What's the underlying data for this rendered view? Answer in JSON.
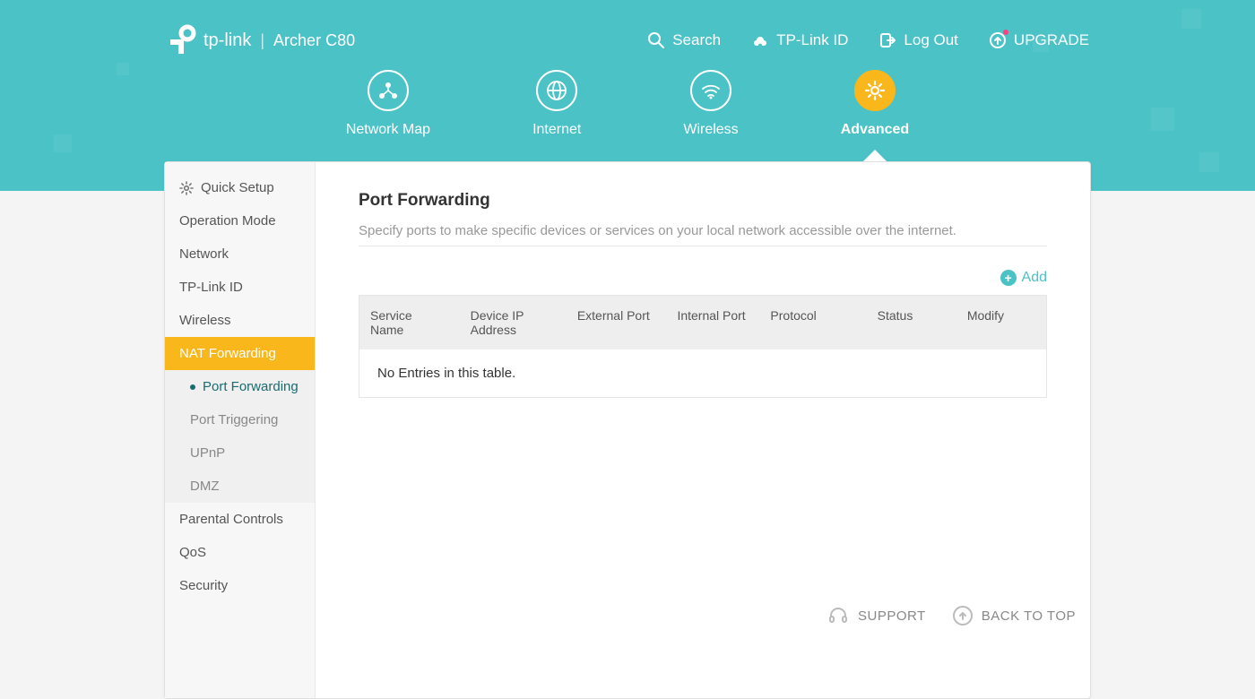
{
  "brand": "tp-link",
  "model": "Archer C80",
  "top_links": {
    "search": "Search",
    "tplink_id": "TP-Link ID",
    "logout": "Log Out",
    "upgrade": "UPGRADE"
  },
  "tabs": {
    "network_map": "Network Map",
    "internet": "Internet",
    "wireless": "Wireless",
    "advanced": "Advanced"
  },
  "sidebar": {
    "quick_setup": "Quick Setup",
    "operation_mode": "Operation Mode",
    "network": "Network",
    "tplink_id": "TP-Link ID",
    "wireless": "Wireless",
    "nat_forwarding": "NAT Forwarding",
    "sub": {
      "port_forwarding": "Port Forwarding",
      "port_triggering": "Port Triggering",
      "upnp": "UPnP",
      "dmz": "DMZ"
    },
    "parental_controls": "Parental Controls",
    "qos": "QoS",
    "security": "Security"
  },
  "page": {
    "title": "Port Forwarding",
    "desc": "Specify ports to make specific devices or services on your local network accessible over the internet.",
    "add": "Add",
    "columns": {
      "service_name": "Service Name",
      "device_ip": "Device IP Address",
      "external_port": "External Port",
      "internal_port": "Internal Port",
      "protocol": "Protocol",
      "status": "Status",
      "modify": "Modify"
    },
    "empty": "No Entries in this table."
  },
  "footer": {
    "support": "SUPPORT",
    "back_to_top": "BACK TO TOP"
  }
}
